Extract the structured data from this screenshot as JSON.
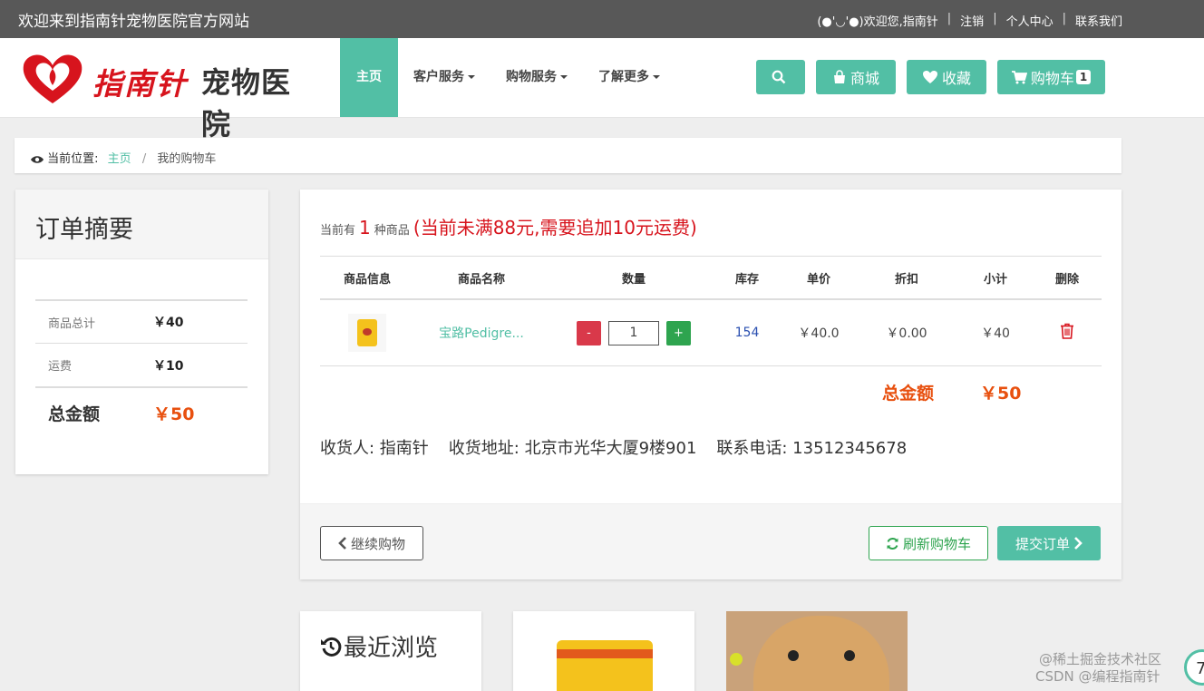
{
  "topbar": {
    "welcome": "欢迎来到指南针宠物医院官方网站",
    "greeting": "(●'◡'●)欢迎您,指南针",
    "logout": "注销",
    "user_center": "个人中心",
    "contact": "联系我们",
    "separator": "|"
  },
  "logo": {
    "brand1": "指南针",
    "brand2": "宠物医院"
  },
  "menu": {
    "home": "主页",
    "customer_service": "客户服务",
    "shopping_service": "购物服务",
    "learn_more": "了解更多"
  },
  "nav_buttons": {
    "mall": "商城",
    "favorites": "收藏",
    "cart": "购物车",
    "cart_count": "1"
  },
  "breadcrumb": {
    "label": "当前位置:",
    "home": "主页",
    "separator": "/",
    "current": "我的购物车"
  },
  "summary": {
    "title": "订单摘要",
    "goods_total_label": "商品总计",
    "goods_total_value": "￥40",
    "shipping_label": "运费",
    "shipping_value": "￥10",
    "grand_total_label": "总金额",
    "grand_total_value": "￥50"
  },
  "cart": {
    "notice_prefix": "当前有",
    "notice_count": "1",
    "notice_suffix": "种商品",
    "notice_warning": "(当前未满88元,需要追加10元运费)",
    "headers": [
      "商品信息",
      "商品名称",
      "数量",
      "库存",
      "单价",
      "折扣",
      "小计",
      "删除"
    ],
    "item": {
      "name": "宝路Pedigre...",
      "minus": "-",
      "quantity": "1",
      "plus": "+",
      "stock": "154",
      "unit_price": "￥40.0",
      "discount": "￥0.00",
      "subtotal": "￥40"
    },
    "total_label": "总金额",
    "total_value": "￥50",
    "receiver": "收货人: 指南针",
    "address": "收货地址: 北京市光华大厦9楼901",
    "phone": "联系电话: 13512345678",
    "continue_button": "继续购物",
    "refresh_button": "刷新购物车",
    "submit_button": "提交订单"
  },
  "recent": {
    "title": "最近浏览"
  },
  "watermark": {
    "line1": "@稀土掘金技术社区",
    "line2": "CSDN @编程指南针",
    "badge": "7"
  },
  "colors": {
    "accent": "#52bfa5",
    "danger": "#d7141d",
    "price": "#e8500f",
    "topbar": "#585858"
  }
}
